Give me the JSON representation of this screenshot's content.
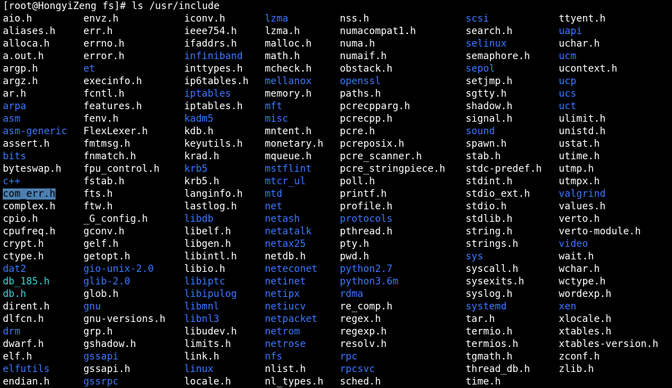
{
  "colors": {
    "background": "#000000",
    "file": "#ffffff",
    "directory": "#3b78ff",
    "symlink": "#3ad6d6",
    "selection": "#4c7fb0"
  },
  "terminal": {
    "prompt": "[root@HongyiZeng fs]# ",
    "command": "ls /usr/include",
    "columns": [
      [
        {
          "name": "aio.h",
          "kind": "file"
        },
        {
          "name": "aliases.h",
          "kind": "file"
        },
        {
          "name": "alloca.h",
          "kind": "file"
        },
        {
          "name": "a.out.h",
          "kind": "file"
        },
        {
          "name": "argp.h",
          "kind": "file"
        },
        {
          "name": "argz.h",
          "kind": "file"
        },
        {
          "name": "ar.h",
          "kind": "file"
        },
        {
          "name": "arpa",
          "kind": "directory"
        },
        {
          "name": "asm",
          "kind": "directory"
        },
        {
          "name": "asm-generic",
          "kind": "directory"
        },
        {
          "name": "assert.h",
          "kind": "file"
        },
        {
          "name": "bits",
          "kind": "directory"
        },
        {
          "name": "byteswap.h",
          "kind": "file"
        },
        {
          "name": "c++",
          "kind": "directory"
        },
        {
          "name": "com_err.h",
          "kind": "selected"
        },
        {
          "name": "complex.h",
          "kind": "file"
        },
        {
          "name": "cpio.h",
          "kind": "file"
        },
        {
          "name": "cpufreq.h",
          "kind": "file"
        },
        {
          "name": "crypt.h",
          "kind": "file"
        },
        {
          "name": "ctype.h",
          "kind": "file"
        },
        {
          "name": "dat2",
          "kind": "directory"
        },
        {
          "name": "db_185.h",
          "kind": "symlink"
        },
        {
          "name": "db.h",
          "kind": "symlink"
        },
        {
          "name": "dirent.h",
          "kind": "file"
        },
        {
          "name": "dlfcn.h",
          "kind": "file"
        },
        {
          "name": "drm",
          "kind": "directory"
        },
        {
          "name": "dwarf.h",
          "kind": "file"
        },
        {
          "name": "elf.h",
          "kind": "file"
        },
        {
          "name": "elfutils",
          "kind": "directory"
        },
        {
          "name": "endian.h",
          "kind": "file"
        }
      ],
      [
        {
          "name": "envz.h",
          "kind": "file"
        },
        {
          "name": "err.h",
          "kind": "file"
        },
        {
          "name": "errno.h",
          "kind": "file"
        },
        {
          "name": "error.h",
          "kind": "file"
        },
        {
          "name": "et",
          "kind": "directory"
        },
        {
          "name": "execinfo.h",
          "kind": "file"
        },
        {
          "name": "fcntl.h",
          "kind": "file"
        },
        {
          "name": "features.h",
          "kind": "file"
        },
        {
          "name": "fenv.h",
          "kind": "file"
        },
        {
          "name": "FlexLexer.h",
          "kind": "file"
        },
        {
          "name": "fmtmsg.h",
          "kind": "file"
        },
        {
          "name": "fnmatch.h",
          "kind": "file"
        },
        {
          "name": "fpu_control.h",
          "kind": "file"
        },
        {
          "name": "fstab.h",
          "kind": "file"
        },
        {
          "name": "fts.h",
          "kind": "file"
        },
        {
          "name": "ftw.h",
          "kind": "file"
        },
        {
          "name": "_G_config.h",
          "kind": "file"
        },
        {
          "name": "gconv.h",
          "kind": "file"
        },
        {
          "name": "gelf.h",
          "kind": "file"
        },
        {
          "name": "getopt.h",
          "kind": "file"
        },
        {
          "name": "gio-unix-2.0",
          "kind": "directory"
        },
        {
          "name": "glib-2.0",
          "kind": "directory"
        },
        {
          "name": "glob.h",
          "kind": "file"
        },
        {
          "name": "gnu",
          "kind": "directory"
        },
        {
          "name": "gnu-versions.h",
          "kind": "file"
        },
        {
          "name": "grp.h",
          "kind": "file"
        },
        {
          "name": "gshadow.h",
          "kind": "file"
        },
        {
          "name": "gssapi",
          "kind": "directory"
        },
        {
          "name": "gssapi.h",
          "kind": "file"
        },
        {
          "name": "gssrpc",
          "kind": "directory"
        }
      ],
      [
        {
          "name": "iconv.h",
          "kind": "file"
        },
        {
          "name": "ieee754.h",
          "kind": "file"
        },
        {
          "name": "ifaddrs.h",
          "kind": "file"
        },
        {
          "name": "infiniband",
          "kind": "directory"
        },
        {
          "name": "inttypes.h",
          "kind": "file"
        },
        {
          "name": "ip6tables.h",
          "kind": "file"
        },
        {
          "name": "iptables",
          "kind": "directory"
        },
        {
          "name": "iptables.h",
          "kind": "file"
        },
        {
          "name": "kadm5",
          "kind": "directory"
        },
        {
          "name": "kdb.h",
          "kind": "file"
        },
        {
          "name": "keyutils.h",
          "kind": "file"
        },
        {
          "name": "krad.h",
          "kind": "file"
        },
        {
          "name": "krb5",
          "kind": "directory"
        },
        {
          "name": "krb5.h",
          "kind": "file"
        },
        {
          "name": "langinfo.h",
          "kind": "file"
        },
        {
          "name": "lastlog.h",
          "kind": "file"
        },
        {
          "name": "libdb",
          "kind": "directory"
        },
        {
          "name": "libelf.h",
          "kind": "file"
        },
        {
          "name": "libgen.h",
          "kind": "file"
        },
        {
          "name": "libintl.h",
          "kind": "file"
        },
        {
          "name": "libio.h",
          "kind": "file"
        },
        {
          "name": "libiptc",
          "kind": "directory"
        },
        {
          "name": "libipulog",
          "kind": "directory"
        },
        {
          "name": "libmnl",
          "kind": "directory"
        },
        {
          "name": "libnl3",
          "kind": "directory"
        },
        {
          "name": "libudev.h",
          "kind": "file"
        },
        {
          "name": "limits.h",
          "kind": "file"
        },
        {
          "name": "link.h",
          "kind": "file"
        },
        {
          "name": "linux",
          "kind": "directory"
        },
        {
          "name": "locale.h",
          "kind": "file"
        }
      ],
      [
        {
          "name": "lzma",
          "kind": "directory"
        },
        {
          "name": "lzma.h",
          "kind": "file"
        },
        {
          "name": "malloc.h",
          "kind": "file"
        },
        {
          "name": "math.h",
          "kind": "file"
        },
        {
          "name": "mcheck.h",
          "kind": "file"
        },
        {
          "name": "mellanox",
          "kind": "directory"
        },
        {
          "name": "memory.h",
          "kind": "file"
        },
        {
          "name": "mft",
          "kind": "directory"
        },
        {
          "name": "misc",
          "kind": "directory"
        },
        {
          "name": "mntent.h",
          "kind": "file"
        },
        {
          "name": "monetary.h",
          "kind": "file"
        },
        {
          "name": "mqueue.h",
          "kind": "file"
        },
        {
          "name": "mstflint",
          "kind": "directory"
        },
        {
          "name": "mtcr_ul",
          "kind": "directory"
        },
        {
          "name": "mtd",
          "kind": "directory"
        },
        {
          "name": "net",
          "kind": "directory"
        },
        {
          "name": "netash",
          "kind": "directory"
        },
        {
          "name": "netatalk",
          "kind": "directory"
        },
        {
          "name": "netax25",
          "kind": "directory"
        },
        {
          "name": "netdb.h",
          "kind": "file"
        },
        {
          "name": "neteconet",
          "kind": "directory"
        },
        {
          "name": "netinet",
          "kind": "directory"
        },
        {
          "name": "netipx",
          "kind": "directory"
        },
        {
          "name": "netiucv",
          "kind": "directory"
        },
        {
          "name": "netpacket",
          "kind": "directory"
        },
        {
          "name": "netrom",
          "kind": "directory"
        },
        {
          "name": "netrose",
          "kind": "directory"
        },
        {
          "name": "nfs",
          "kind": "directory"
        },
        {
          "name": "nlist.h",
          "kind": "file"
        },
        {
          "name": "nl_types.h",
          "kind": "file"
        }
      ],
      [
        {
          "name": "nss.h",
          "kind": "file"
        },
        {
          "name": "numacompat1.h",
          "kind": "file"
        },
        {
          "name": "numa.h",
          "kind": "file"
        },
        {
          "name": "numaif.h",
          "kind": "file"
        },
        {
          "name": "obstack.h",
          "kind": "file"
        },
        {
          "name": "openssl",
          "kind": "directory"
        },
        {
          "name": "paths.h",
          "kind": "file"
        },
        {
          "name": "pcrecpparg.h",
          "kind": "file"
        },
        {
          "name": "pcrecpp.h",
          "kind": "file"
        },
        {
          "name": "pcre.h",
          "kind": "file"
        },
        {
          "name": "pcreposix.h",
          "kind": "file"
        },
        {
          "name": "pcre_scanner.h",
          "kind": "file"
        },
        {
          "name": "pcre_stringpiece.h",
          "kind": "file"
        },
        {
          "name": "poll.h",
          "kind": "file"
        },
        {
          "name": "printf.h",
          "kind": "file"
        },
        {
          "name": "profile.h",
          "kind": "file"
        },
        {
          "name": "protocols",
          "kind": "directory"
        },
        {
          "name": "pthread.h",
          "kind": "file"
        },
        {
          "name": "pty.h",
          "kind": "file"
        },
        {
          "name": "pwd.h",
          "kind": "file"
        },
        {
          "name": "python2.7",
          "kind": "directory"
        },
        {
          "name": "python3.6m",
          "kind": "directory"
        },
        {
          "name": "rdma",
          "kind": "directory"
        },
        {
          "name": "re_comp.h",
          "kind": "file"
        },
        {
          "name": "regex.h",
          "kind": "file"
        },
        {
          "name": "regexp.h",
          "kind": "file"
        },
        {
          "name": "resolv.h",
          "kind": "file"
        },
        {
          "name": "rpc",
          "kind": "directory"
        },
        {
          "name": "rpcsvc",
          "kind": "directory"
        },
        {
          "name": "sched.h",
          "kind": "file"
        }
      ],
      [
        {
          "name": "scsi",
          "kind": "directory"
        },
        {
          "name": "search.h",
          "kind": "file"
        },
        {
          "name": "selinux",
          "kind": "directory"
        },
        {
          "name": "semaphore.h",
          "kind": "file"
        },
        {
          "name": "sepol",
          "kind": "directory"
        },
        {
          "name": "setjmp.h",
          "kind": "file"
        },
        {
          "name": "sgtty.h",
          "kind": "file"
        },
        {
          "name": "shadow.h",
          "kind": "file"
        },
        {
          "name": "signal.h",
          "kind": "file"
        },
        {
          "name": "sound",
          "kind": "directory"
        },
        {
          "name": "spawn.h",
          "kind": "file"
        },
        {
          "name": "stab.h",
          "kind": "file"
        },
        {
          "name": "stdc-predef.h",
          "kind": "file"
        },
        {
          "name": "stdint.h",
          "kind": "file"
        },
        {
          "name": "stdio_ext.h",
          "kind": "file"
        },
        {
          "name": "stdio.h",
          "kind": "file"
        },
        {
          "name": "stdlib.h",
          "kind": "file"
        },
        {
          "name": "string.h",
          "kind": "file"
        },
        {
          "name": "strings.h",
          "kind": "file"
        },
        {
          "name": "sys",
          "kind": "directory"
        },
        {
          "name": "syscall.h",
          "kind": "file"
        },
        {
          "name": "sysexits.h",
          "kind": "file"
        },
        {
          "name": "syslog.h",
          "kind": "file"
        },
        {
          "name": "systemd",
          "kind": "directory"
        },
        {
          "name": "tar.h",
          "kind": "file"
        },
        {
          "name": "termio.h",
          "kind": "file"
        },
        {
          "name": "termios.h",
          "kind": "file"
        },
        {
          "name": "tgmath.h",
          "kind": "file"
        },
        {
          "name": "thread_db.h",
          "kind": "file"
        },
        {
          "name": "time.h",
          "kind": "file"
        }
      ],
      [
        {
          "name": "ttyent.h",
          "kind": "file"
        },
        {
          "name": "uapi",
          "kind": "directory"
        },
        {
          "name": "uchar.h",
          "kind": "file"
        },
        {
          "name": "ucm",
          "kind": "directory"
        },
        {
          "name": "ucontext.h",
          "kind": "file"
        },
        {
          "name": "ucp",
          "kind": "directory"
        },
        {
          "name": "ucs",
          "kind": "directory"
        },
        {
          "name": "uct",
          "kind": "directory"
        },
        {
          "name": "ulimit.h",
          "kind": "file"
        },
        {
          "name": "unistd.h",
          "kind": "file"
        },
        {
          "name": "ustat.h",
          "kind": "file"
        },
        {
          "name": "utime.h",
          "kind": "file"
        },
        {
          "name": "utmp.h",
          "kind": "file"
        },
        {
          "name": "utmpx.h",
          "kind": "file"
        },
        {
          "name": "valgrind",
          "kind": "directory"
        },
        {
          "name": "values.h",
          "kind": "file"
        },
        {
          "name": "verto.h",
          "kind": "file"
        },
        {
          "name": "verto-module.h",
          "kind": "file"
        },
        {
          "name": "video",
          "kind": "directory"
        },
        {
          "name": "wait.h",
          "kind": "file"
        },
        {
          "name": "wchar.h",
          "kind": "file"
        },
        {
          "name": "wctype.h",
          "kind": "file"
        },
        {
          "name": "wordexp.h",
          "kind": "file"
        },
        {
          "name": "xen",
          "kind": "directory"
        },
        {
          "name": "xlocale.h",
          "kind": "file"
        },
        {
          "name": "xtables.h",
          "kind": "file"
        },
        {
          "name": "xtables-version.h",
          "kind": "file"
        },
        {
          "name": "zconf.h",
          "kind": "file"
        },
        {
          "name": "zlib.h",
          "kind": "file"
        }
      ]
    ]
  }
}
